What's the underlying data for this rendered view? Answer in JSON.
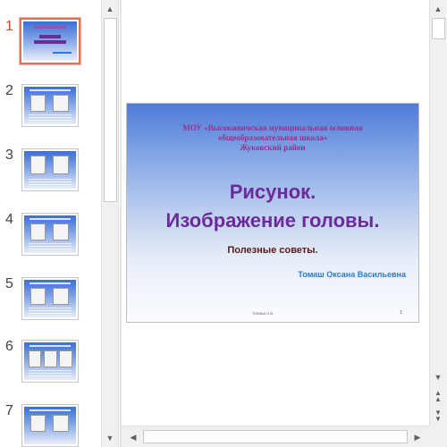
{
  "thumbnails": [
    {
      "number": "1",
      "active": true
    },
    {
      "number": "2",
      "active": false
    },
    {
      "number": "3",
      "active": false
    },
    {
      "number": "4",
      "active": false
    },
    {
      "number": "5",
      "active": false
    },
    {
      "number": "6",
      "active": false
    },
    {
      "number": "7",
      "active": false
    }
  ],
  "slide": {
    "school_line1": "МОУ «Высокиничская муниципальная основная",
    "school_line2": "общеобразовательная школа»",
    "school_line3": "Жуковский район",
    "title_line1": "Рисунок.",
    "title_line2": "Изображение головы.",
    "subtitle": "Полезные советы.",
    "author": "Томаш Оксана Васильевна",
    "footer_center": "ТОМАШ О.В.",
    "footer_page": "1"
  },
  "icons": {
    "scroll_up": "triangle-up",
    "scroll_down": "triangle-down",
    "scroll_left": "triangle-left",
    "scroll_right": "triangle-right",
    "prev_slide": "double-chevron-up",
    "next_slide": "double-chevron-down"
  },
  "colors": {
    "active_number": "#d24726",
    "title": "#6d2a9a",
    "school": "#9a2f8e",
    "author": "#2b7bd0"
  }
}
